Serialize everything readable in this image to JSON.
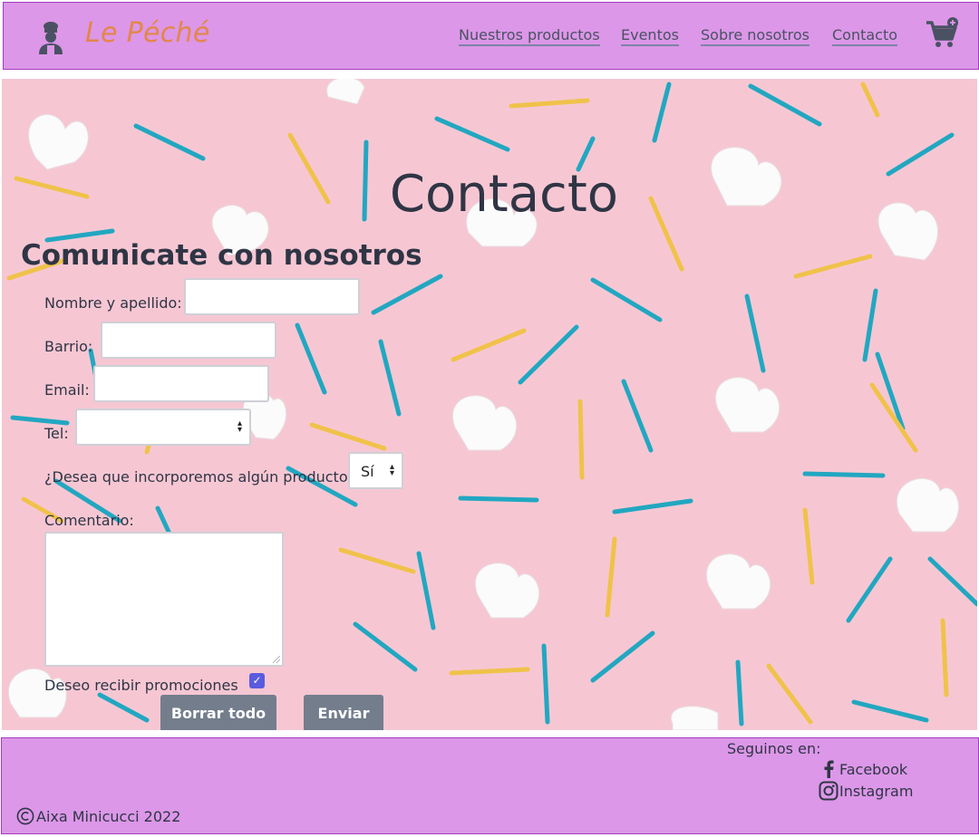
{
  "header": {
    "brand": "Le Péché",
    "nav": [
      "Nuestros productos",
      "Eventos",
      "Sobre nosotros",
      "Contacto"
    ]
  },
  "hero": {
    "title": "Contacto"
  },
  "form": {
    "heading": "Comunicate con nosotros",
    "name_label": "Nombre y apellido:",
    "name_value": "",
    "barrio_label": "Barrio:",
    "barrio_value": "",
    "email_label": "Email:",
    "email_value": "",
    "tel_label": "Tel:",
    "tel_value": "",
    "product_question": "¿Desea que incorporemos algún producto?",
    "product_selected": "Sí",
    "comment_label": "Comentario:",
    "comment_value": "",
    "promo_label": "Deseo recibir promociones",
    "promo_checked": true,
    "reset_label": "Borrar todo",
    "submit_label": "Enviar"
  },
  "footer": {
    "follow_label": "Seguinos en:",
    "facebook": "Facebook",
    "instagram": "Instagram",
    "copyright": "Aixa Minicucci 2022"
  },
  "colors": {
    "header_bg": "#dc97e8",
    "brand": "#e2874a",
    "hero_bg": "#f6c7d3",
    "button_bg": "#747d8c",
    "checkbox": "#5b5be0"
  },
  "icons": [
    "chef-icon",
    "cart-add-icon",
    "facebook-icon",
    "instagram-icon",
    "copyright-icon"
  ]
}
